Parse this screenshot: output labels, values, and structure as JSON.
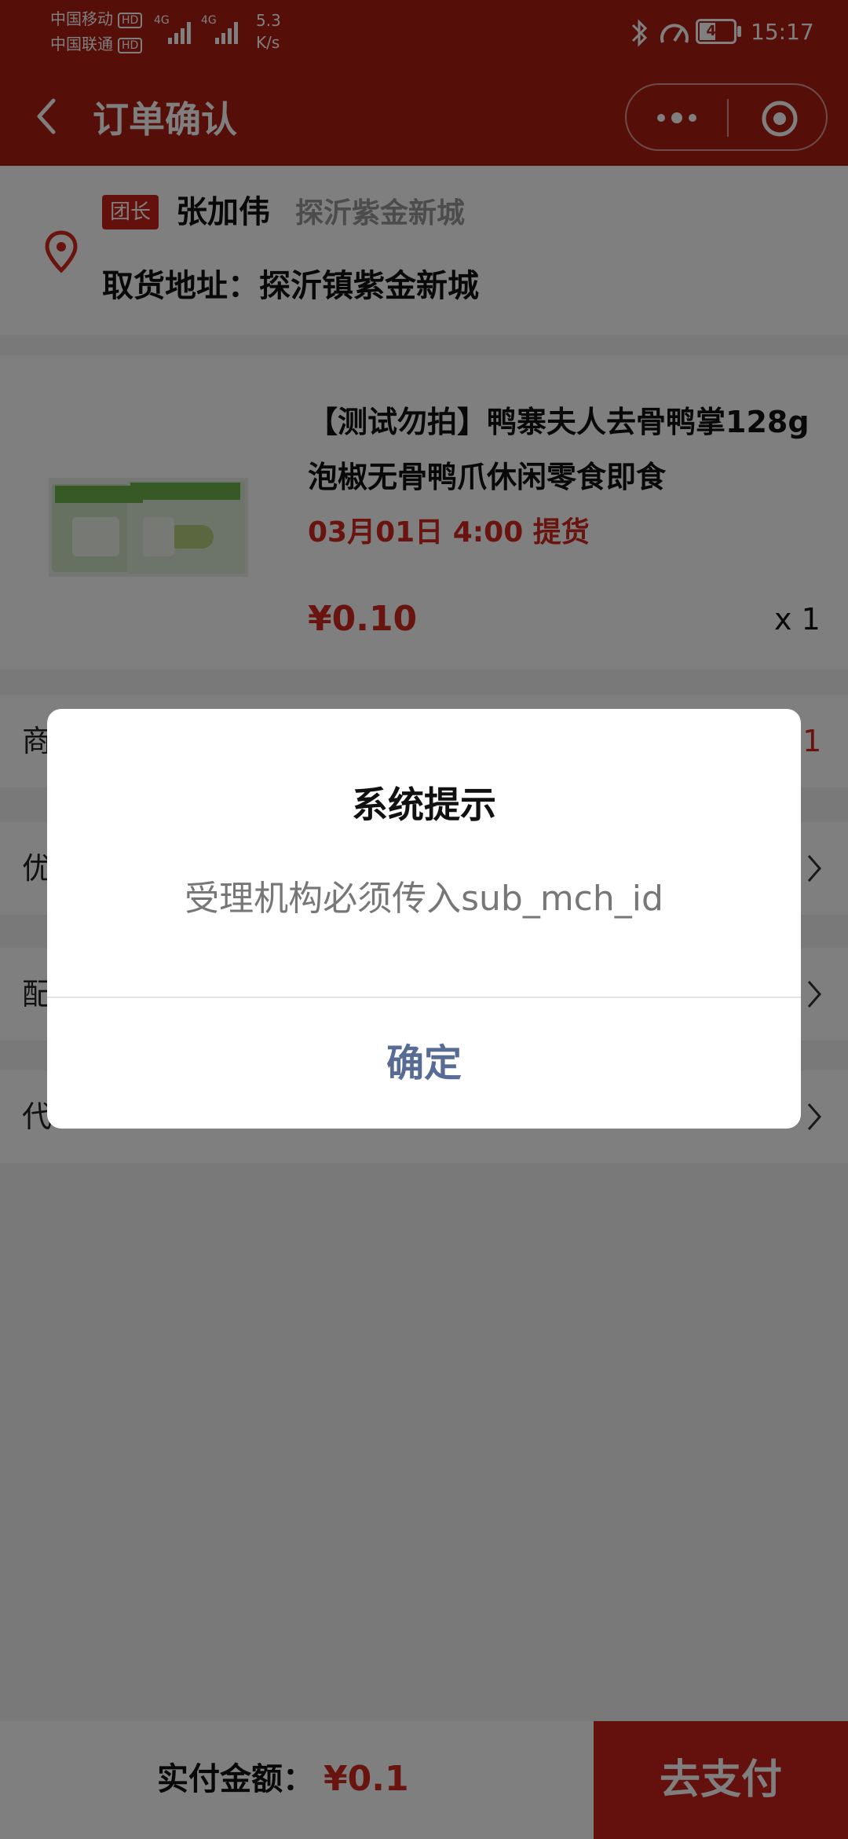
{
  "status_bar": {
    "carrier1": "中国移动",
    "carrier2": "中国联通",
    "hd": "HD",
    "net1": "4G",
    "net2": "4G",
    "speed_value": "5.3",
    "speed_unit": "K/s",
    "battery": "45",
    "time": "15:17"
  },
  "header": {
    "title": "订单确认"
  },
  "address": {
    "leader_tag": "团长",
    "leader_name": "张加伟",
    "community": "探沂紫金新城",
    "pickup_address": "取货地址：探沂镇紫金新城"
  },
  "product": {
    "title": "【测试勿拍】鸭寨夫人去骨鸭掌128g泡椒无骨鸭爪休闲零食即食",
    "pickup_time": "03月01日 4:00 提货",
    "price": "¥0.10",
    "quantity": "x 1"
  },
  "rows": {
    "row1_label": "商",
    "row1_value": ".1",
    "row2_label": "优",
    "row3_label": "配",
    "row4_label": "代"
  },
  "bottom_bar": {
    "pay_label": "实付金额：",
    "pay_amount": "¥0.1",
    "pay_button": "去支付"
  },
  "dialog": {
    "title": "系统提示",
    "message": "受理机构必须传入sub_mch_id",
    "confirm": "确定"
  },
  "colors": {
    "brand_red": "#ac1d12",
    "price_red": "#d2291e",
    "dialog_button_blue": "#576b95"
  }
}
